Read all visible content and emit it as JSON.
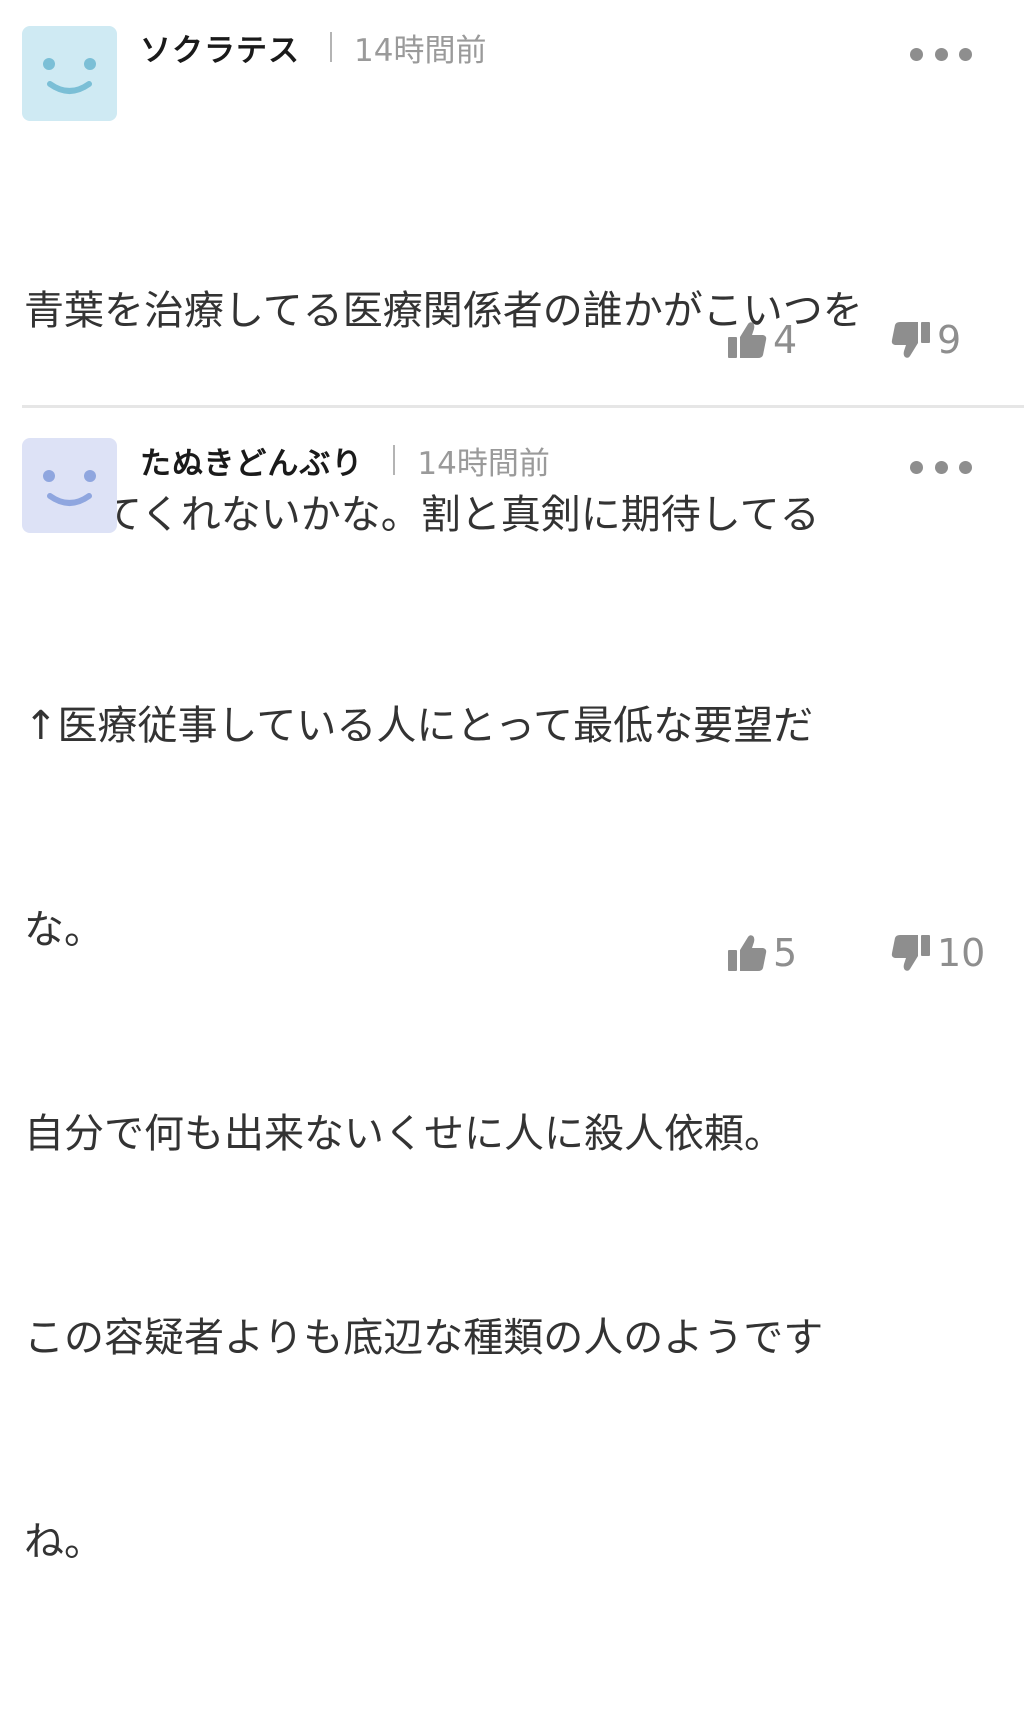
{
  "comments": [
    {
      "username": "ソクラテス",
      "time": "14時間前",
      "avatar_color": "#cfeaf3",
      "avatar_face_color": "#7bbfd6",
      "lines": [
        "青葉を治療してる医療関係者の誰かがこいつを",
        "葬ってくれないかな。割と真剣に期待してる"
      ],
      "likes": "4",
      "dislikes": "9"
    },
    {
      "username": "たぬきどんぶり",
      "time": "14時間前",
      "avatar_color": "#dde2f6",
      "avatar_face_color": "#8fa6df",
      "lines": [
        "↑医療従事している人にとって最低な要望だ",
        "な。",
        "自分で何も出来ないくせに人に殺人依頼。",
        "この容疑者よりも底辺な種類の人のようです",
        "ね。"
      ],
      "likes": "5",
      "dislikes": "10"
    }
  ],
  "icons": {
    "more": "more-options-icon",
    "like": "thumbs-up-icon",
    "dislike": "thumbs-down-icon"
  },
  "colors": {
    "text": "#333333",
    "muted": "#8e8e8e",
    "divider": "#e6e6e6"
  }
}
